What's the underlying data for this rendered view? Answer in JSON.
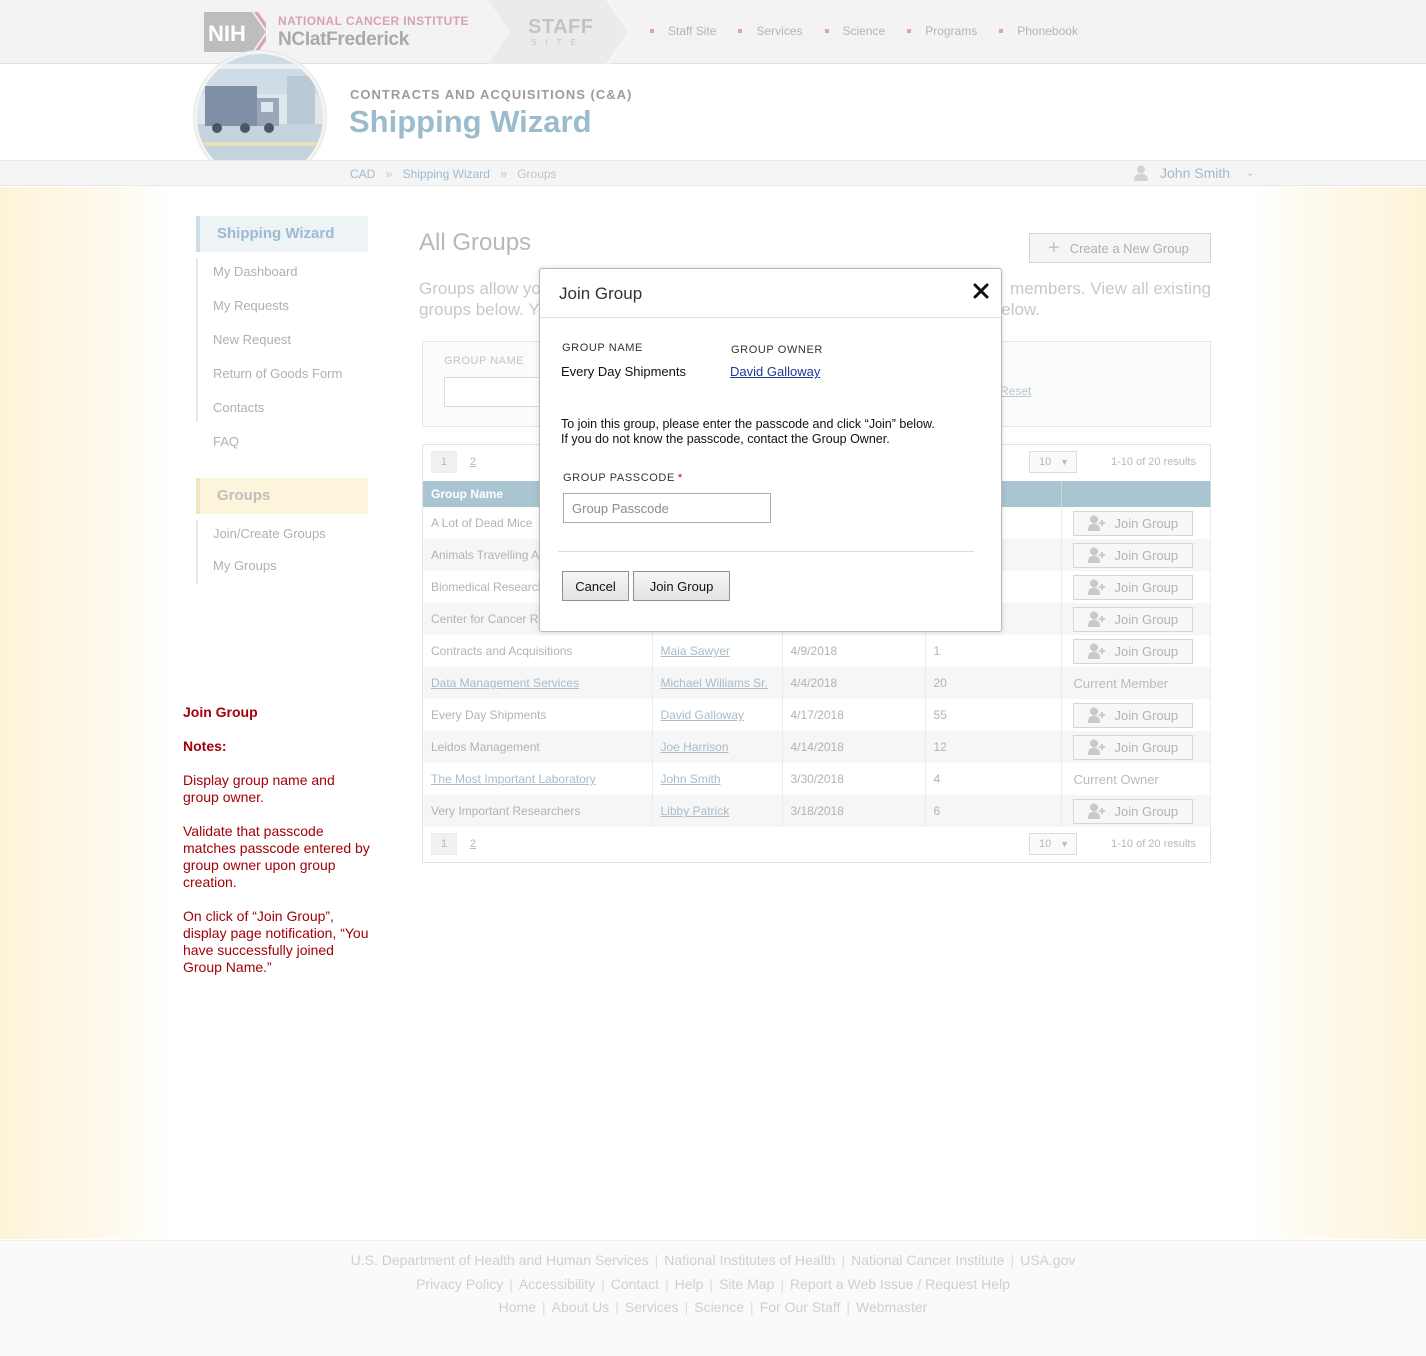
{
  "header": {
    "nih_logo": "NIH",
    "nci_line1": "NATIONAL CANCER INSTITUTE",
    "nci_line2": "NCIatFrederick",
    "staff_word": "STAFF",
    "site_word": "SITE",
    "nav": [
      "Staff Site",
      "Services",
      "Science",
      "Programs",
      "Phonebook"
    ]
  },
  "banner": {
    "section_label": "CONTRACTS AND ACQUISITIONS (C&A)",
    "app_title": "Shipping Wizard"
  },
  "breadcrumb": {
    "items": [
      "CAD",
      "Shipping Wizard"
    ],
    "separator": "»",
    "current": "Groups"
  },
  "user": {
    "name": "John Smith",
    "icon": "user-icon",
    "caret": "⌄"
  },
  "sidebar": {
    "wizard_heading": "Shipping Wizard",
    "wizard_items": [
      "My Dashboard",
      "My Requests",
      "New Request",
      "Return of Goods Form",
      "Contacts",
      "FAQ"
    ],
    "groups_heading": "Groups",
    "groups_items": [
      "Join/Create Groups",
      "My Groups"
    ]
  },
  "notes": {
    "title": "Join Group",
    "label": "Notes:",
    "paragraphs": [
      "Display group name and group owner.",
      "Validate that passcode matches passcode entered by group owner upon group creation.",
      "On click of “Join Group”, display page notification, “You have successfully joined Group Name.”"
    ]
  },
  "main": {
    "title": "All Groups",
    "create_button": "Create a New Group",
    "intro_left": "Groups allow yo",
    "intro_right": "members. View all existing",
    "intro_left2": "groups below. Y",
    "intro_right2": "elow.",
    "filter_label": "GROUP NAME",
    "reset_link": "Reset"
  },
  "pagination": {
    "pages": [
      "1",
      "2"
    ],
    "per_page": "10",
    "results": "1-10 of 20 results"
  },
  "table": {
    "header_first": "Group Name",
    "join_label": "Join Group",
    "rows": [
      {
        "name": "A Lot of Dead Mice",
        "owner": "",
        "date": "",
        "count": "",
        "action": "join",
        "status": "",
        "linked": false
      },
      {
        "name": "Animals Travelling A",
        "owner": "",
        "date": "",
        "count": "",
        "action": "join",
        "status": "",
        "linked": false
      },
      {
        "name": "Biomedical Research",
        "owner": "",
        "date": "",
        "count": "",
        "action": "join",
        "status": "",
        "linked": false
      },
      {
        "name": "Center for Cancer R",
        "owner": "",
        "date": "",
        "count": "",
        "action": "join",
        "status": "",
        "linked": false
      },
      {
        "name": "Contracts and Acquisitions",
        "owner": "Maia Sawyer",
        "date": "4/9/2018",
        "count": "1",
        "action": "join",
        "status": "",
        "linked": false
      },
      {
        "name": "Data Management Services",
        "owner": "Michael Williams Sr.",
        "date": "4/4/2018",
        "count": "20",
        "action": "status",
        "status": "Current Member",
        "linked": true
      },
      {
        "name": "Every Day Shipments",
        "owner": "David Galloway",
        "date": "4/17/2018",
        "count": "55",
        "action": "join",
        "status": "",
        "linked": false
      },
      {
        "name": "Leidos Management",
        "owner": "Joe Harrison",
        "date": "4/14/2018",
        "count": "12",
        "action": "join",
        "status": "",
        "linked": false
      },
      {
        "name": "The Most Important Laboratory",
        "owner": "John Smith",
        "date": "3/30/2018",
        "count": "4",
        "action": "status",
        "status": "Current Owner",
        "linked": true
      },
      {
        "name": "Very Important Researchers",
        "owner": "Libby Patrick",
        "date": "3/18/2018",
        "count": "6",
        "action": "join",
        "status": "",
        "linked": false
      }
    ]
  },
  "modal": {
    "title": "Join Group",
    "close_icon": "close-icon",
    "group_name_label": "GROUP NAME",
    "group_name_value": "Every Day Shipments",
    "group_owner_label": "GROUP OWNER",
    "group_owner_value": "David Galloway",
    "instructions_line1": "To join this group, please enter the passcode and click “Join” below.",
    "instructions_line2": "If you do not know the passcode, contact the Group Owner.",
    "passcode_label": "GROUP PASSCODE",
    "required_mark": "*",
    "passcode_placeholder": "Group Passcode",
    "passcode_value": "",
    "cancel_button": "Cancel",
    "join_button": "Join Group"
  },
  "footer": {
    "row1": [
      "U.S. Department of Health and Human Services",
      "National Institutes of Health",
      "National Cancer Institute",
      "USA.gov"
    ],
    "row2": [
      "Privacy Policy",
      "Accessibility",
      "Contact",
      "Help",
      "Site Map",
      "Report a Web Issue / Request Help"
    ],
    "row3": [
      "Home",
      "About Us",
      "Services",
      "Science",
      "For Our Staff",
      "Webmaster"
    ]
  },
  "colors": {
    "accent": "#9bbccc",
    "table_header": "#a9c5d2",
    "notes_text": "#a3000a",
    "modal_link": "#1f3a93"
  }
}
